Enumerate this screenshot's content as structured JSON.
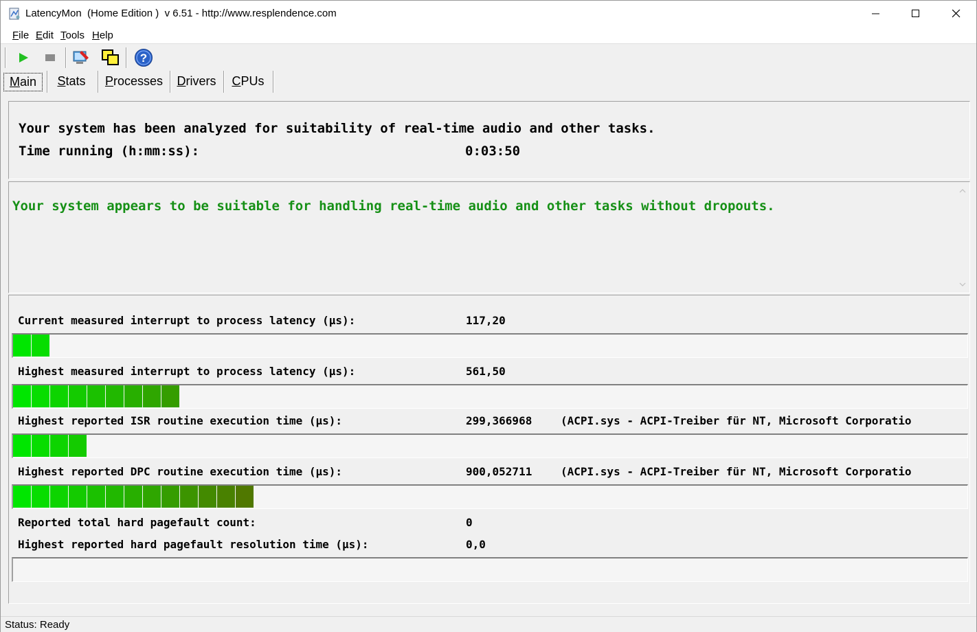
{
  "window": {
    "title": "LatencyMon  (Home Edition )  v 6.51 - http://www.resplendence.com"
  },
  "menu": [
    {
      "first": "F",
      "rest": "ile"
    },
    {
      "first": "E",
      "rest": "dit"
    },
    {
      "first": "T",
      "rest": "ools"
    },
    {
      "first": "H",
      "rest": "elp"
    }
  ],
  "toolbar": {
    "icons": [
      "play-icon",
      "stop-icon",
      "analyze-icon",
      "window-icon",
      "help-icon"
    ]
  },
  "tabs": [
    {
      "first": "M",
      "rest": "ain",
      "active": true
    },
    {
      "first": "S",
      "rest": "tats"
    },
    {
      "first": "P",
      "rest": "rocesses"
    },
    {
      "first": "D",
      "rest": "rivers"
    },
    {
      "first": "C",
      "rest": "PUs"
    }
  ],
  "summary": {
    "line1": "Your system has been analyzed for suitability of real-time audio and other tasks.",
    "time_label": "Time running (h:mm:ss):",
    "time_value": "0:03:50"
  },
  "verdict": {
    "text": "Your system appears to be suitable for handling real-time audio and other tasks without dropouts.",
    "color": "#169016"
  },
  "metrics": [
    {
      "label": "Current measured interrupt to process latency (µs):",
      "value": "117,20",
      "extra": "",
      "bar_segments": 2
    },
    {
      "label": "Highest measured interrupt to process latency (µs):",
      "value": "561,50",
      "extra": "",
      "bar_segments": 9
    },
    {
      "label": "Highest reported ISR routine execution time (µs):",
      "value": "299,366968",
      "extra": "(ACPI.sys - ACPI-Treiber für NT, Microsoft Corporatio",
      "bar_segments": 4
    },
    {
      "label": "Highest reported DPC routine execution time (µs):",
      "value": "900,052711",
      "extra": "(ACPI.sys - ACPI-Treiber für NT, Microsoft Corporatio",
      "bar_segments": 13
    },
    {
      "label": "Reported total hard pagefault count:",
      "value": "0",
      "extra": ""
    },
    {
      "label": "Highest reported hard pagefault resolution time (µs):",
      "value": "0,0",
      "extra": "",
      "bar_segments": 0
    }
  ],
  "status": {
    "text": "Status: Ready"
  }
}
